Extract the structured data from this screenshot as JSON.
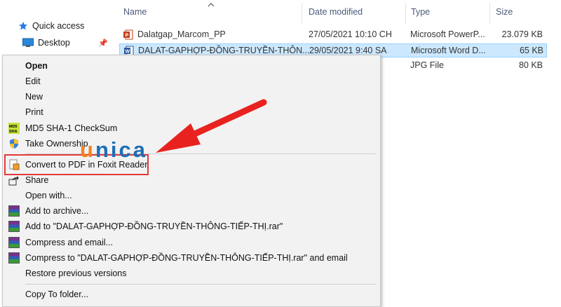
{
  "nav": {
    "quick_access": "Quick access",
    "desktop": "Desktop"
  },
  "columns": {
    "name": "Name",
    "date_modified": "Date modified",
    "type": "Type",
    "size": "Size"
  },
  "files": [
    {
      "name": "Dalatgap_Marcom_PP",
      "date": "27/05/2021 10:10 CH",
      "type": "Microsoft PowerP...",
      "size": "23.079 KB",
      "icon": "powerpoint-icon"
    },
    {
      "name": "DALAT-GAPHỢP-ĐỒNG-TRUYỀN-THÔN...",
      "date": "29/05/2021 9:40 SA",
      "type": "Microsoft Word D...",
      "size": "65 KB",
      "icon": "word-icon"
    },
    {
      "name": "",
      "date": "",
      "type": "JPG File",
      "size": "80 KB",
      "icon": ""
    }
  ],
  "menu": {
    "open": "Open",
    "edit": "Edit",
    "new": "New",
    "print": "Print",
    "md5": "MD5 SHA-1 CheckSum",
    "take_ownership": "Take Ownership",
    "convert_pdf": "Convert to PDF in Foxit Reader",
    "share": "Share",
    "open_with": "Open with...",
    "add_archive": "Add to archive...",
    "add_rar": "Add to \"DALAT-GAPHỢP-ĐỒNG-TRUYỀN-THÔNG-TIẾP-THỊ.rar\"",
    "compress_email": "Compress and email...",
    "compress_rar_email": "Compress to \"DALAT-GAPHỢP-ĐỒNG-TRUYỀN-THÔNG-TIẾP-THỊ.rar\" and email",
    "restore": "Restore previous versions",
    "copy_to": "Copy To folder..."
  },
  "logo": {
    "u": "u",
    "rest": "nica"
  },
  "colors": {
    "highlight": "#e23b3b",
    "selection": "#cce8ff",
    "arrow": "#e8231f"
  }
}
